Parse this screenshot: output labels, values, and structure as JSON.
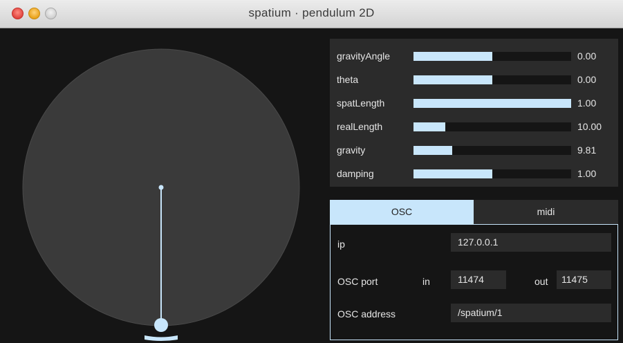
{
  "window": {
    "title": "spatium · pendulum 2D",
    "buttons": [
      "close",
      "minimize",
      "zoom"
    ]
  },
  "colors": {
    "background": "#151515",
    "panel": "#2b2b2b",
    "accent": "#c8e6fb",
    "text": "#e6e6e6"
  },
  "pendulum": {
    "circle_fill": "#3a3a3a",
    "bob_color": "#c8e6fb"
  },
  "sliders": [
    {
      "label": "gravityAngle",
      "value": "0.00",
      "fill": 0.5
    },
    {
      "label": "theta",
      "value": "0.00",
      "fill": 0.5
    },
    {
      "label": "spatLength",
      "value": "1.00",
      "fill": 1.0
    },
    {
      "label": "realLength",
      "value": "10.00",
      "fill": 0.2
    },
    {
      "label": "gravity",
      "value": "9.81",
      "fill": 0.245
    },
    {
      "label": "damping",
      "value": "1.00",
      "fill": 0.5
    }
  ],
  "tabs": [
    {
      "label": "OSC",
      "active": true
    },
    {
      "label": "midi",
      "active": false
    }
  ],
  "osc": {
    "ip_label": "ip",
    "ip_value": "127.0.0.1",
    "port_label": "OSC port",
    "in_label": "in",
    "in_value": "11474",
    "out_label": "out",
    "out_value": "11475",
    "address_label": "OSC address",
    "address_value": "/spatium/1"
  }
}
